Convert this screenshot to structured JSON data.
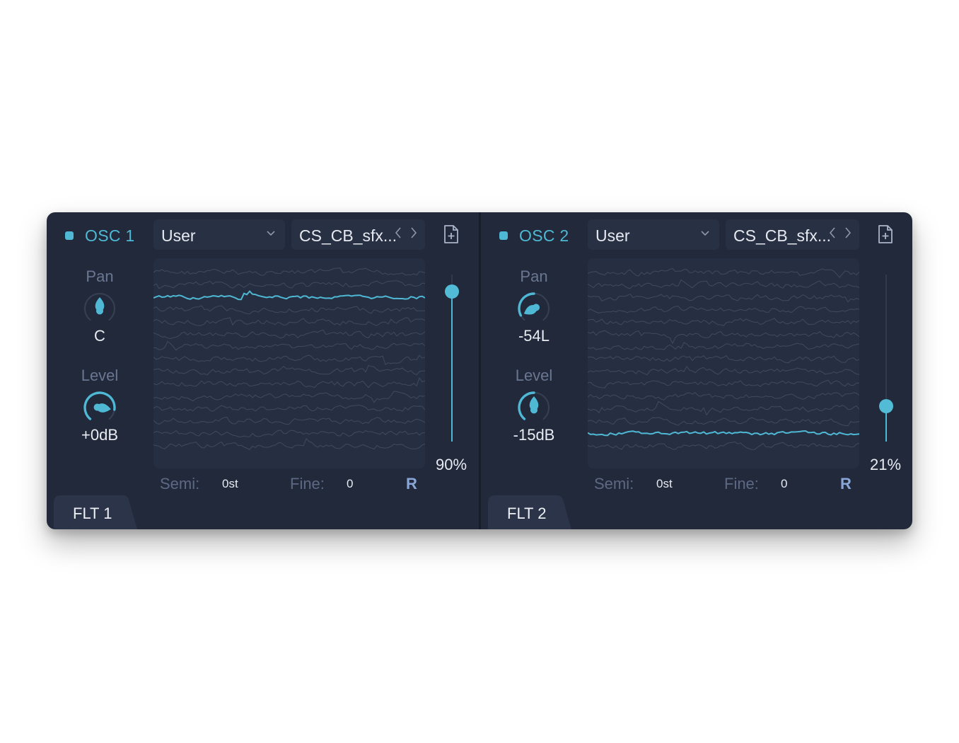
{
  "oscillators": [
    {
      "title": "OSC 1",
      "type_dropdown": "User",
      "wavetable_name": "CS_CB_sfx...",
      "pan": {
        "label": "Pan",
        "value": "C",
        "amount": 0.5
      },
      "level": {
        "label": "Level",
        "value": "+0dB",
        "amount": 0.85
      },
      "position": {
        "value": "90%",
        "fraction": 0.9
      },
      "active_frame": 2,
      "semi": {
        "label": "Semi:",
        "value": "0st"
      },
      "fine": {
        "label": "Fine:",
        "value": "0"
      },
      "reset_label": "R",
      "filter_tab": "FLT 1",
      "icons": [
        "power-icon",
        "chevron-down-icon",
        "chevron-left-icon",
        "chevron-right-icon",
        "add-file-icon"
      ]
    },
    {
      "title": "OSC 2",
      "type_dropdown": "User",
      "wavetable_name": "CS_CB_sfx...",
      "pan": {
        "label": "Pan",
        "value": "-54L",
        "amount": 0.08
      },
      "level": {
        "label": "Level",
        "value": "-15dB",
        "amount": 0.5
      },
      "position": {
        "value": "21%",
        "fraction": 0.21
      },
      "active_frame": 13,
      "semi": {
        "label": "Semi:",
        "value": "0st"
      },
      "fine": {
        "label": "Fine:",
        "value": "0"
      },
      "reset_label": "R",
      "filter_tab": "FLT 2",
      "icons": [
        "power-icon",
        "chevron-down-icon",
        "chevron-left-icon",
        "chevron-right-icon",
        "add-file-icon"
      ]
    }
  ],
  "colors": {
    "panel": "#21293a",
    "accent": "#4fb8d4",
    "text": "#e8ebf2",
    "label": "#6a7792"
  }
}
